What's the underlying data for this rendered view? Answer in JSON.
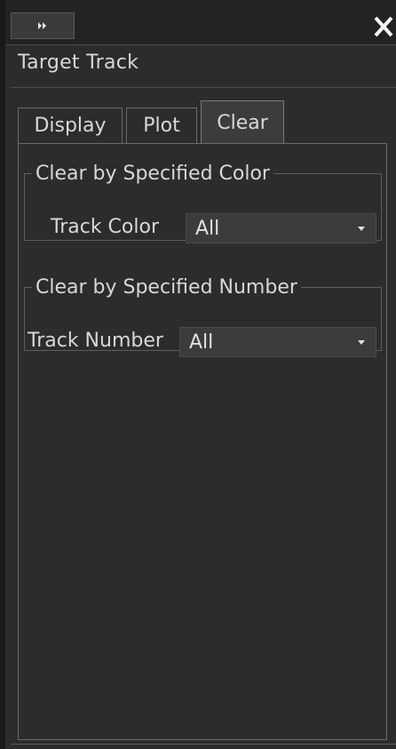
{
  "window": {
    "expand_icon": "double-chevron-right-icon",
    "close_icon": "close-x-icon"
  },
  "panel": {
    "title": "Target Track"
  },
  "tabs": [
    {
      "label": "Display",
      "active": false
    },
    {
      "label": "Plot",
      "active": false
    },
    {
      "label": "Clear",
      "active": true
    }
  ],
  "clear_tab": {
    "color_group": {
      "legend": "Clear by Specified Color",
      "field_label": "Track Color",
      "selected": "All"
    },
    "number_group": {
      "legend": "Clear by Specified Number",
      "field_label": "Track Number",
      "selected": "All"
    }
  },
  "colors": {
    "background": "#2c2c2c",
    "text": "#d8d8d8",
    "border": "#6a6a6a"
  }
}
